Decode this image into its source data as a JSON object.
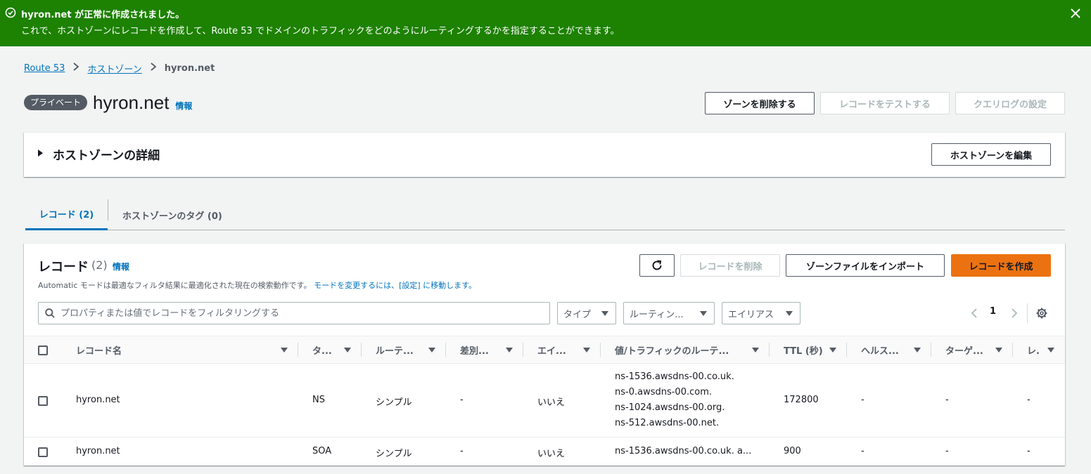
{
  "flash": {
    "title": "hyron.net が正常に作成されました。",
    "message": "これで、ホストゾーンにレコードを作成して、Route 53 でドメインのトラフィックをどのようにルーティングするかを指定することができます。"
  },
  "breadcrumb": {
    "items": [
      "Route 53",
      "ホストゾーン"
    ],
    "current": "hyron.net"
  },
  "header": {
    "badge": "プライベート",
    "title": "hyron.net",
    "info": "情報",
    "buttons": {
      "delete_zone": "ゾーンを削除する",
      "test_record": "レコードをテストする",
      "query_log": "クエリログの設定"
    }
  },
  "details": {
    "title": "ホストゾーンの詳細",
    "edit_button": "ホストゾーンを編集"
  },
  "tabs": [
    {
      "label": "レコード (2)",
      "active": true
    },
    {
      "label": "ホストゾーンのタグ (0)",
      "active": false
    }
  ],
  "records": {
    "title": "レコード",
    "count": "(2)",
    "info": "情報",
    "description": "Automatic モードは最適なフィルタ結果に最適化された現在の検索動作です。",
    "description_link": "モードを変更するには、[設定] に移動します。",
    "buttons": {
      "delete": "レコードを削除",
      "import": "ゾーンファイルをインポート",
      "create": "レコードを作成"
    },
    "search_placeholder": "プロパティまたは値でレコードをフィルタリングする",
    "filters": {
      "type": "タイプ",
      "routing": "ルーティン...",
      "alias": "エイリアス"
    },
    "page": "1",
    "columns": [
      "レコード名",
      "タ...",
      "ルーテ...",
      "差別...",
      "エイ...",
      "値/トラフィックのルーテ...",
      "TTL (秒)",
      "ヘルス...",
      "ターゲ...",
      "レ."
    ],
    "rows": [
      {
        "name": "hyron.net",
        "type": "NS",
        "routing": "シンプル",
        "differentiator": "-",
        "alias": "いいえ",
        "values": [
          "ns-1536.awsdns-00.co.uk.",
          "ns-0.awsdns-00.com.",
          "ns-1024.awsdns-00.org.",
          "ns-512.awsdns-00.net."
        ],
        "ttl": "172800",
        "health": "-",
        "target": "-",
        "record_id": "-"
      },
      {
        "name": "hyron.net",
        "type": "SOA",
        "routing": "シンプル",
        "differentiator": "-",
        "alias": "いいえ",
        "values": [
          "ns-1536.awsdns-00.co.uk. a..."
        ],
        "ttl": "900",
        "health": "-",
        "target": "-",
        "record_id": "-"
      }
    ]
  }
}
